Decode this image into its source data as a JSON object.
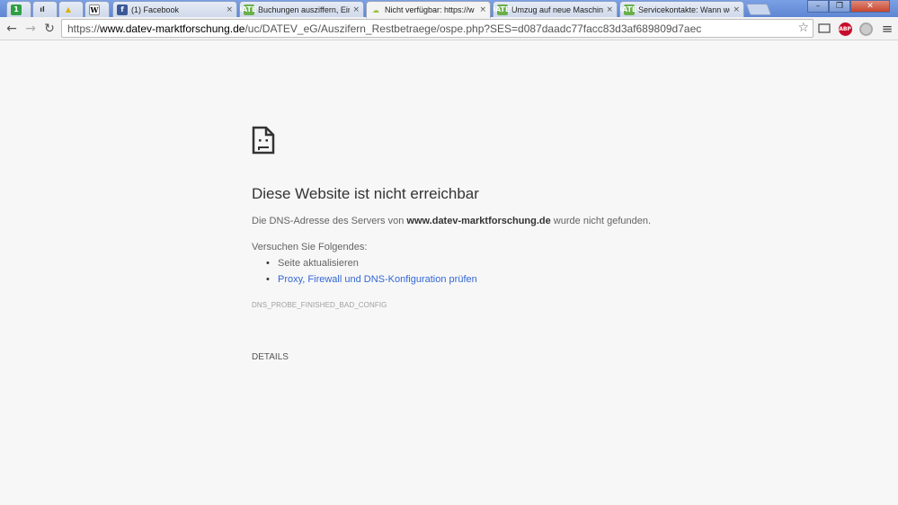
{
  "browser": {
    "tabs": [
      {
        "title": "",
        "favicon": "green-circle-icon",
        "glyph": "1"
      },
      {
        "title": "",
        "favicon": "bars-icon",
        "glyph": "ıl"
      },
      {
        "title": "",
        "favicon": "warning-icon",
        "glyph": "▲"
      },
      {
        "title": "",
        "favicon": "wikipedia-icon",
        "glyph": "W"
      },
      {
        "title": "(1) Facebook",
        "favicon": "facebook-icon",
        "glyph": "f"
      },
      {
        "title": "Buchungen ausziffern, Ein",
        "favicon": "datev-icon",
        "glyph": "DATEV"
      },
      {
        "title": "Nicht verfügbar: https://w",
        "favicon": "cloud-icon",
        "glyph": "☁"
      },
      {
        "title": "Umzug auf neue Maschine",
        "favicon": "datev-icon",
        "glyph": "DATEV"
      },
      {
        "title": "Servicekontakte: Wann we",
        "favicon": "datev-icon",
        "glyph": "DATEV"
      }
    ],
    "close_glyph": "×",
    "window_controls": {
      "minimize": "–",
      "maximize": "❐",
      "close": "✕"
    },
    "toolbar": {
      "back": "←",
      "forward": "→",
      "reload": "↻",
      "url_prefix": "https://",
      "url_host": "www.datev-marktforschung.de",
      "url_path": "/uc/DATEV_eG/Auszifern_Restbetraege/ospe.php?SES=d087daadc77facc83d3af689809d7aec",
      "star": "☆",
      "abp_label": "ABP",
      "menu": "≡"
    }
  },
  "error_page": {
    "title": "Diese Website ist nicht erreichbar",
    "desc_before": "Die DNS-Adresse des Servers von ",
    "desc_host": "www.datev-marktforschung.de",
    "desc_after": " wurde nicht gefunden.",
    "try_label": "Versuchen Sie Folgendes:",
    "suggestions": [
      {
        "text": "Seite aktualisieren",
        "link": false
      },
      {
        "text": "Proxy, Firewall und DNS-Konfiguration prüfen",
        "link": true
      }
    ],
    "error_code": "DNS_PROBE_FINISHED_BAD_CONFIG",
    "details_button": "DETAILS"
  },
  "colors": {
    "link": "#3367d6",
    "background": "#f7f7f7",
    "abp_red": "#c70d2c"
  }
}
